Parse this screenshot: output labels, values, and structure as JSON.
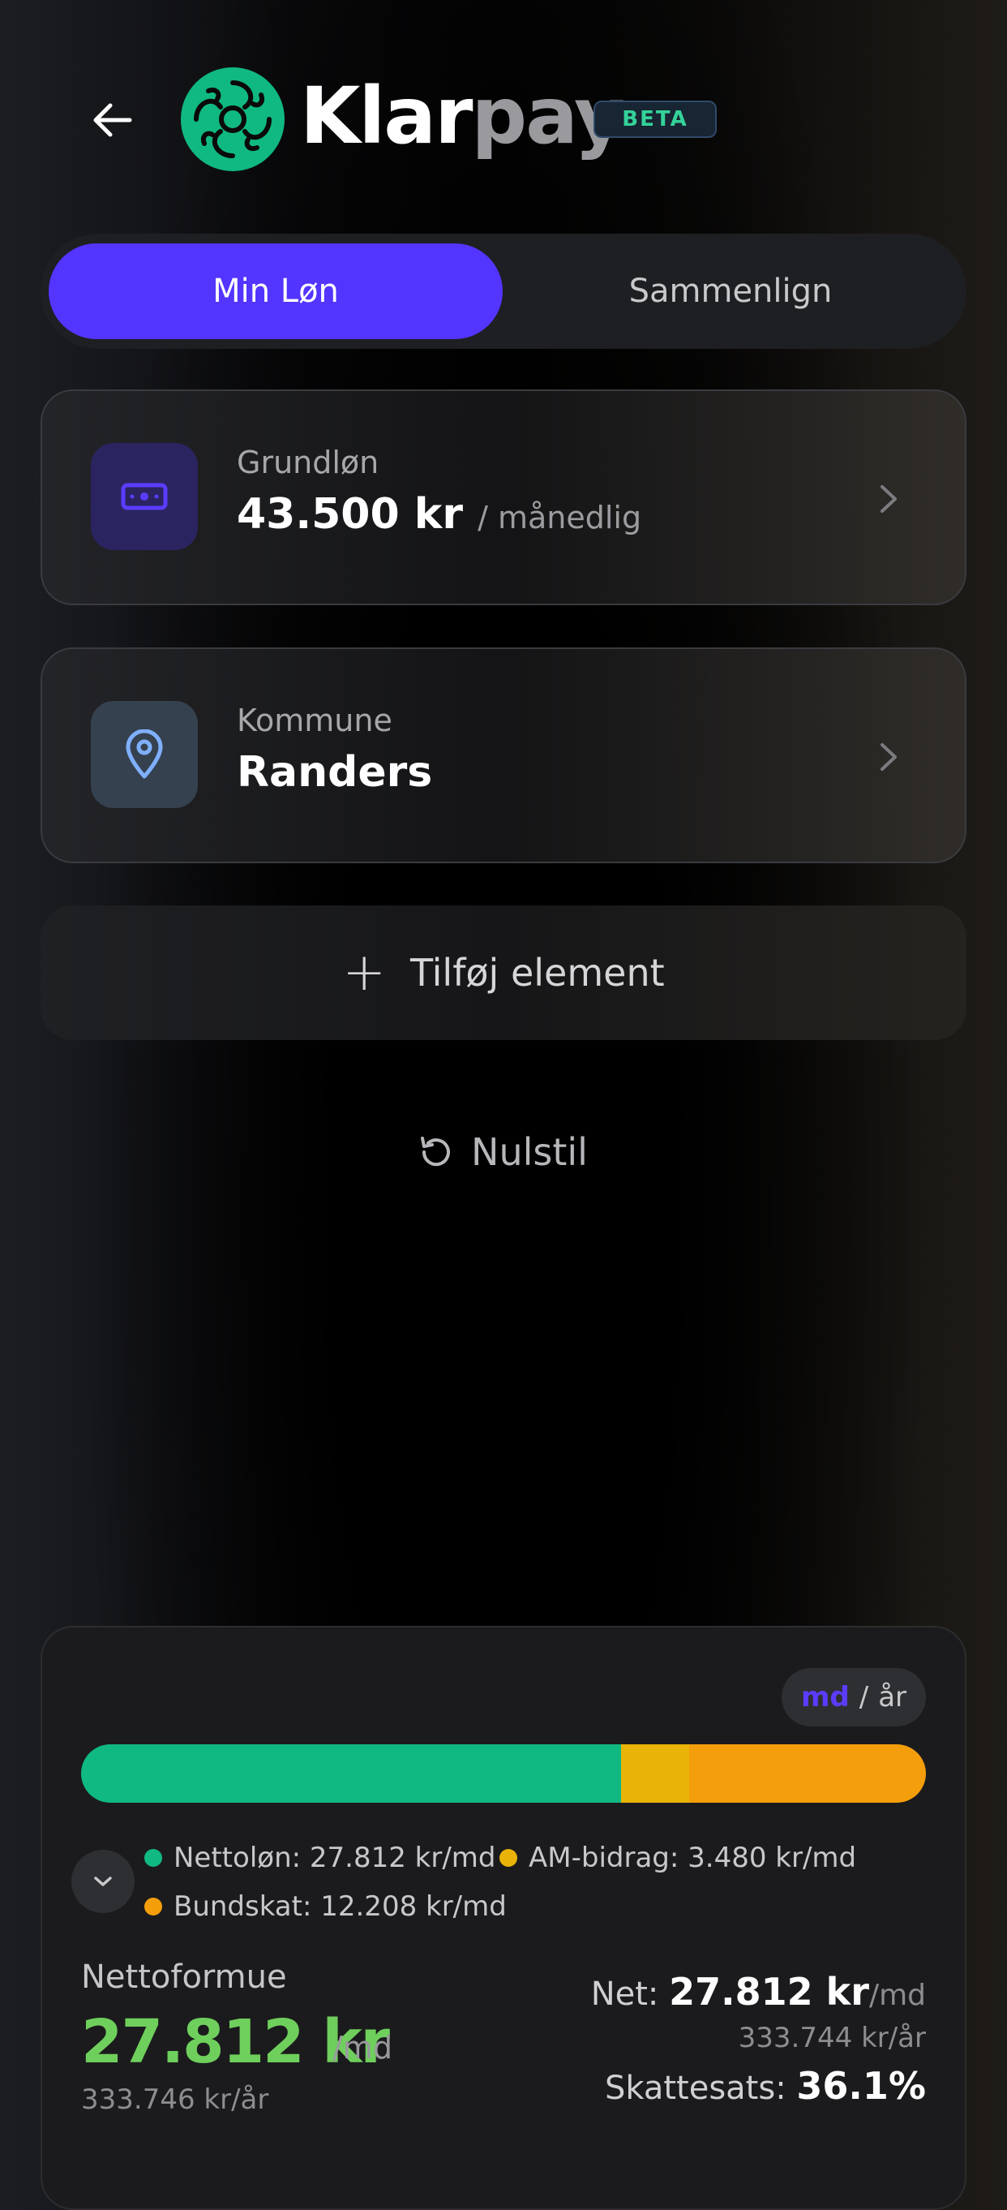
{
  "header": {
    "brand_part1": "Klar",
    "brand_part2": "pay",
    "badge": "BETA"
  },
  "tabs": [
    {
      "label": "Min Løn",
      "active": true
    },
    {
      "label": "Sammenlign",
      "active": false
    }
  ],
  "cards": {
    "salary": {
      "label": "Grundløn",
      "value": "43.500 kr",
      "unit": "/ månedlig",
      "icon": "banknote-icon"
    },
    "municipality": {
      "label": "Kommune",
      "value": "Randers",
      "icon": "map-pin-icon"
    }
  },
  "actions": {
    "add_label": "Tilføj element",
    "reset_label": "Nulstil"
  },
  "summary": {
    "period_toggle": {
      "md": "md",
      "separator": "/",
      "year": "år",
      "selected": "md"
    },
    "breakdown": [
      {
        "label": "Nettoløn: 27.812 kr/md",
        "value": 27812,
        "color": "#10b981"
      },
      {
        "label": "AM-bidrag: 3.480 kr/md",
        "value": 3480,
        "color": "#eab308"
      },
      {
        "label": "Bundskat: 12.208 kr/md",
        "value": 12208,
        "color": "#f59e0b"
      }
    ],
    "net_worth_label": "Nettoformue",
    "net_worth_value": "27.812 kr",
    "net_worth_unit": "/md",
    "net_worth_year": "333.746 kr/år",
    "net_label": "Net:",
    "net_value": "27.812 kr",
    "net_unit": "/md",
    "net_year": "333.744 kr/år",
    "tax_label": "Skattesats:",
    "tax_value": "36.1%"
  },
  "colors": {
    "accent": "#5235ff",
    "green": "#6fcf5c"
  }
}
